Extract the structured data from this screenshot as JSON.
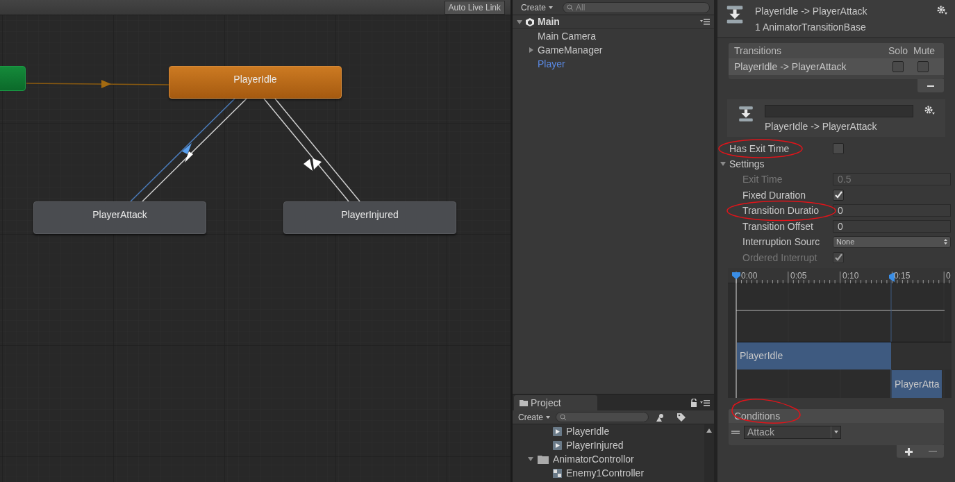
{
  "graph": {
    "toolbar_button": "Auto Live Link",
    "states": [
      {
        "name": "PlayerIdle",
        "kind": "default"
      },
      {
        "name": "PlayerAttack",
        "kind": "normal"
      },
      {
        "name": "PlayerInjured",
        "kind": "normal"
      }
    ]
  },
  "hierarchy": {
    "create": "Create",
    "search_placeholder": "All",
    "scene": "Main",
    "items": [
      {
        "name": "Main Camera",
        "expandable": false,
        "selected": false
      },
      {
        "name": "GameManager",
        "expandable": true,
        "selected": false
      },
      {
        "name": "Player",
        "expandable": false,
        "selected": true
      }
    ]
  },
  "project": {
    "tab": "Project",
    "create": "Create",
    "items": [
      {
        "name": "PlayerIdle",
        "kind": "clip"
      },
      {
        "name": "PlayerInjured",
        "kind": "clip"
      },
      {
        "name": "AnimatorControllor",
        "kind": "folder",
        "expanded": true
      },
      {
        "name": "Enemy1Controller",
        "kind": "controller"
      }
    ]
  },
  "inspector": {
    "title": "PlayerIdle -> PlayerAttack",
    "subtitle": "1 AnimatorTransitionBase",
    "transitions": {
      "header": "Transitions",
      "solo": "Solo",
      "mute": "Mute",
      "rows": [
        {
          "name": "PlayerIdle -> PlayerAttack",
          "solo": false,
          "mute": false,
          "selected": true
        }
      ]
    },
    "transition_name": "PlayerIdle -> PlayerAttack",
    "has_exit_time": {
      "label": "Has Exit Time",
      "checked": false
    },
    "settings": {
      "label": "Settings",
      "expanded": true,
      "rows": [
        {
          "label": "Exit Time",
          "kind": "field",
          "value": "0.5",
          "disabled": true
        },
        {
          "label": "Fixed Duration",
          "kind": "checkbox",
          "checked": true,
          "disabled": false
        },
        {
          "label": "Transition Duratio",
          "kind": "field",
          "value": "0",
          "disabled": false
        },
        {
          "label": "Transition Offset",
          "kind": "field",
          "value": "0",
          "disabled": false
        },
        {
          "label": "Interruption Sourc",
          "kind": "dropdown",
          "value": "None",
          "disabled": false
        },
        {
          "label": "Ordered Interrupt",
          "kind": "checkbox",
          "checked": true,
          "disabled": true
        }
      ]
    },
    "timeline": {
      "ticks": [
        "0:00",
        "0:05",
        "0:10",
        "0:15",
        "0"
      ],
      "clips": [
        "PlayerIdle",
        "PlayerAtta"
      ]
    },
    "conditions": {
      "header": "Conditions",
      "items": [
        {
          "parameter": "Attack"
        }
      ]
    }
  }
}
